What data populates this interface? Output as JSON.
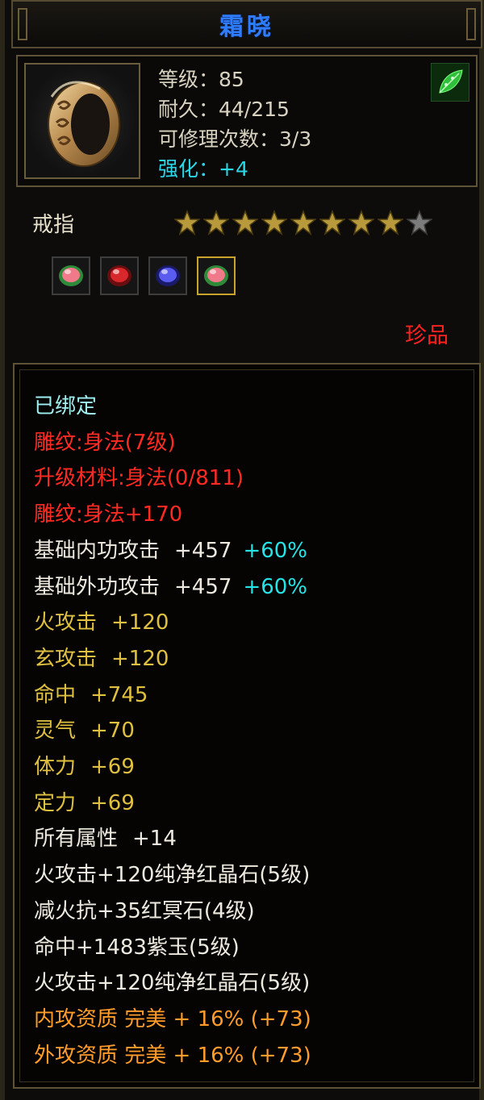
{
  "item": {
    "name": "霜晓",
    "level": "等级：85",
    "durability": "耐久：44/215",
    "repair": "可修理次数：3/3",
    "enhance": "强化：+4",
    "type": "戒指",
    "rarity": "珍品",
    "icon": "ring-icon",
    "badge_icon": "green-leaf-icon"
  },
  "stars": {
    "filled": 8,
    "total": 9
  },
  "gems": [
    {
      "icon": "pink-gem-icon",
      "selected": false
    },
    {
      "icon": "red-gem-icon",
      "selected": false
    },
    {
      "icon": "blue-gem-icon",
      "selected": false
    },
    {
      "icon": "pink-gem-icon",
      "selected": true
    }
  ],
  "details": {
    "bound": "已绑定",
    "engrave": "雕纹:身法(7级)",
    "upgrade_material": "升级材料:身法(0/811)",
    "engrave_bonus": "雕纹:身法+170",
    "stats": [
      {
        "label": "基础内功攻击",
        "value": "+457",
        "extra": "+60%",
        "color": "white"
      },
      {
        "label": "基础外功攻击",
        "value": "+457",
        "extra": "+60%",
        "color": "white"
      },
      {
        "label": "火攻击",
        "value": "+120",
        "extra": "",
        "color": "gold"
      },
      {
        "label": "玄攻击",
        "value": "+120",
        "extra": "",
        "color": "gold"
      },
      {
        "label": "命中",
        "value": "+745",
        "extra": "",
        "color": "gold"
      },
      {
        "label": "灵气",
        "value": "+70",
        "extra": "",
        "color": "gold"
      },
      {
        "label": "体力",
        "value": "+69",
        "extra": "",
        "color": "gold"
      },
      {
        "label": "定力",
        "value": "+69",
        "extra": "",
        "color": "gold"
      },
      {
        "label": "所有属性",
        "value": "+14",
        "extra": "",
        "color": "white"
      }
    ],
    "gem_lines": [
      "火攻击+120纯净红晶石(5级)",
      "减火抗+35红冥石(4级)",
      "命中+1483紫玉(5级)",
      "火攻击+120纯净红晶石(5级)"
    ],
    "qualities": [
      "内攻资质 完美 + 16% (+73)",
      "外攻资质 完美 + 16% (+73)"
    ]
  },
  "colors": {
    "title": "#2f7cff",
    "enhance": "#29d6e6",
    "red_text": "#ff2a22",
    "gold_text": "#e0c040",
    "orange_text": "#ff9c2a",
    "cyan_extra": "#26e3e6"
  }
}
